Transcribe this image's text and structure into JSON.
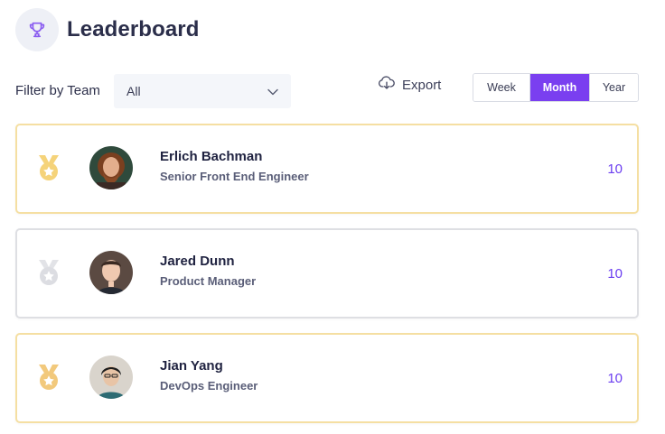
{
  "header": {
    "title": "Leaderboard",
    "icon": "trophy-icon"
  },
  "filter": {
    "label": "Filter by Team",
    "selected": "All"
  },
  "export": {
    "label": "Export",
    "icon": "cloud-download-icon"
  },
  "period": {
    "options": [
      "Week",
      "Month",
      "Year"
    ],
    "active": "Month"
  },
  "colors": {
    "accent": "#7a3ff0",
    "gold": "#f5d37a",
    "silver": "#dcdde2",
    "bronze": "#f2c97c"
  },
  "entries": [
    {
      "name": "Erlich Bachman",
      "role": "Senior Front End Engineer",
      "score": "10",
      "medal": "gold"
    },
    {
      "name": "Jared Dunn",
      "role": "Product Manager",
      "score": "10",
      "medal": "silver"
    },
    {
      "name": "Jian Yang",
      "role": "DevOps Engineer",
      "score": "10",
      "medal": "bronze"
    }
  ]
}
